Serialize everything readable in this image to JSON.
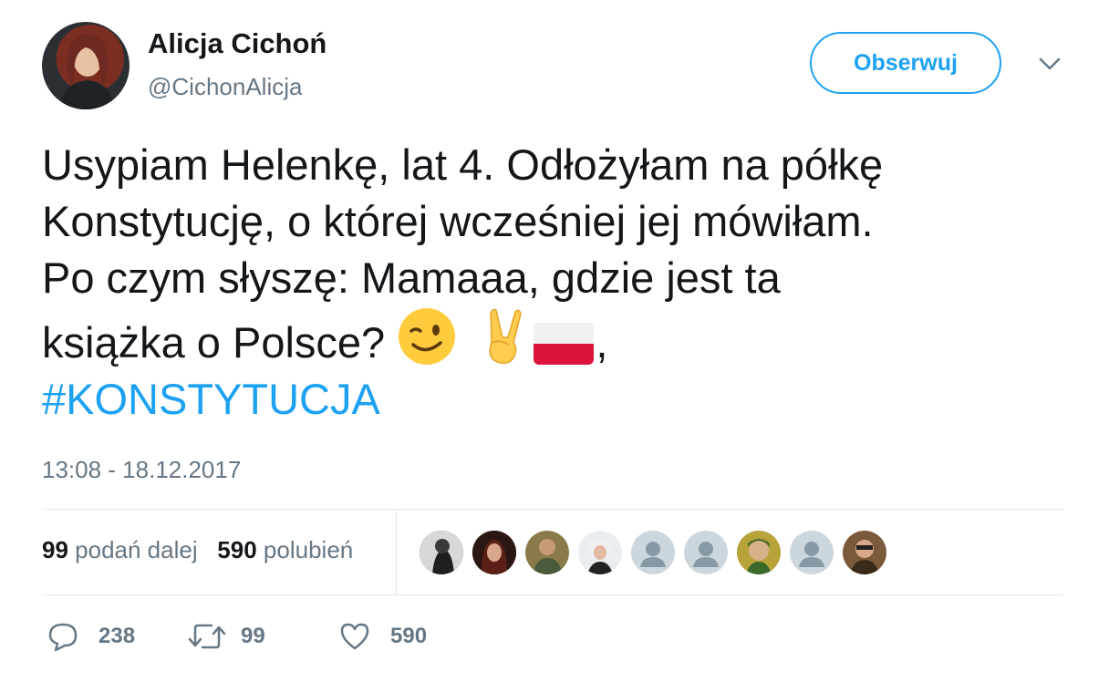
{
  "author": {
    "name": "Alicja Cichoń",
    "handle": "@CichonAlicja",
    "avatar_icon": "profile-photo"
  },
  "follow_button": {
    "label": "Obserwuj"
  },
  "menu_icon": "chevron-down-icon",
  "tweet": {
    "lines": [
      "Usypiam Helenkę, lat 4. Odłożyłam na półkę",
      "Konstytucję, o której wcześniej jej mówiłam.",
      "Po czym słyszę: Mamaaa, gdzie jest ta",
      "książka o Polsce?"
    ],
    "emojis": [
      "winking-face",
      "victory-hand",
      "poland-flag"
    ],
    "trailing": ",",
    "hashtag": "#KONSTYTUCJA"
  },
  "timestamp": "13:08 - 18.12.2017",
  "stats": {
    "retweets_count": "99",
    "retweets_label": "podań dalej",
    "likes_count": "590",
    "likes_label": "polubień"
  },
  "likers": [
    "photo",
    "photo",
    "photo",
    "photo",
    "default",
    "default",
    "photo",
    "default",
    "photo"
  ],
  "actions": {
    "reply_count": "238",
    "retweet_count": "99",
    "like_count": "590"
  },
  "colors": {
    "accent": "#1da1f2",
    "text": "#14171a",
    "muted": "#657786",
    "divider": "#e1e8ed"
  }
}
